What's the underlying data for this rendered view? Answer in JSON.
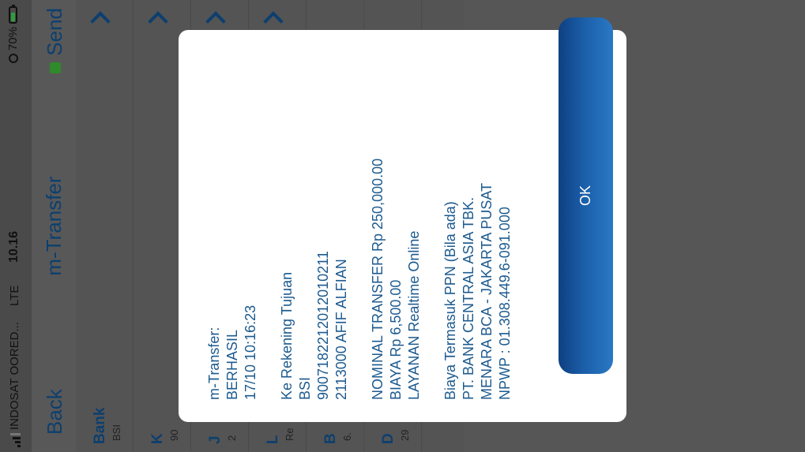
{
  "status_bar": {
    "carrier": "INDOSAT OORED...",
    "network": "LTE",
    "time": "10.16",
    "battery_percent": "70%",
    "battery_level": 0.7
  },
  "nav": {
    "back_label": "Back",
    "title": "m-Transfer",
    "send_label": "Send"
  },
  "form": {
    "rows": [
      {
        "label": "Bank",
        "sub": "BSI"
      },
      {
        "label": "K",
        "sub": "90"
      },
      {
        "label": "J",
        "sub": "2"
      },
      {
        "label": "L",
        "sub": "Re"
      },
      {
        "label": "B",
        "sub": "6."
      },
      {
        "label": "D",
        "sub": "29"
      }
    ]
  },
  "dialog": {
    "lines": [
      "m-Transfer:",
      "BERHASIL",
      "17/10 10:16:23",
      "",
      "Ke Rekening Tujuan",
      "BSI",
      "900718221201201021​1",
      "2113000 AFIF ALFIAN",
      "",
      "NOMINAL TRANSFER Rp 250,000.00",
      "BIAYA Rp 6,500.00",
      "LAYANAN Realtime Online",
      "",
      "Biaya Termasuk PPN (Bila ada)",
      "PT. BANK CENTRAL ASIA TBK.",
      "MENARA BCA - JAKARTA PUSAT",
      "NPWP : 01.308.449.6-091.000"
    ],
    "ok_label": "OK"
  },
  "colors": {
    "link": "#0d3f6e",
    "dialog_text": "#1c5a8f",
    "ok_button_top": "#0f3f82",
    "ok_button_bottom": "#2a78c4",
    "overlay_gray": "#585858"
  },
  "icons": [
    "signal-icon",
    "alarm-icon",
    "battery-icon",
    "send-status-icon",
    "chevron-up-icon"
  ]
}
